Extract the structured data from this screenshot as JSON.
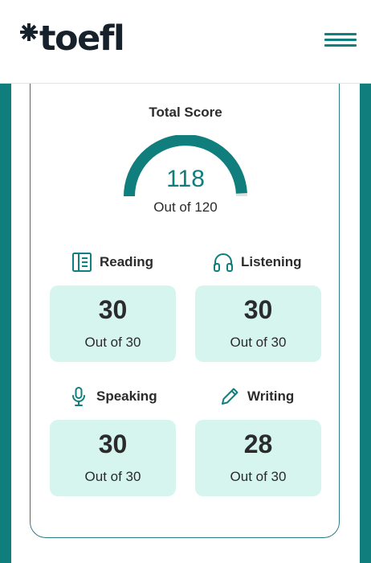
{
  "header": {
    "logo_text": "toefl",
    "menu_icon": "hamburger-menu-icon",
    "brand_color": "#0f7e7c"
  },
  "total": {
    "label": "Total Score",
    "value": "118",
    "out_of": "Out of 120",
    "score": 118,
    "max": 120
  },
  "sections": [
    {
      "name": "Reading",
      "icon": "book-icon",
      "score": "30",
      "out_of": "Out of 30"
    },
    {
      "name": "Listening",
      "icon": "headphones-icon",
      "score": "30",
      "out_of": "Out of 30"
    },
    {
      "name": "Speaking",
      "icon": "microphone-icon",
      "score": "30",
      "out_of": "Out of 30"
    },
    {
      "name": "Writing",
      "icon": "pencil-icon",
      "score": "28",
      "out_of": "Out of 30"
    }
  ],
  "colors": {
    "accent": "#0f7e7c",
    "score_box": "#d6f5ef",
    "gauge_track": "#e0e0e0"
  }
}
